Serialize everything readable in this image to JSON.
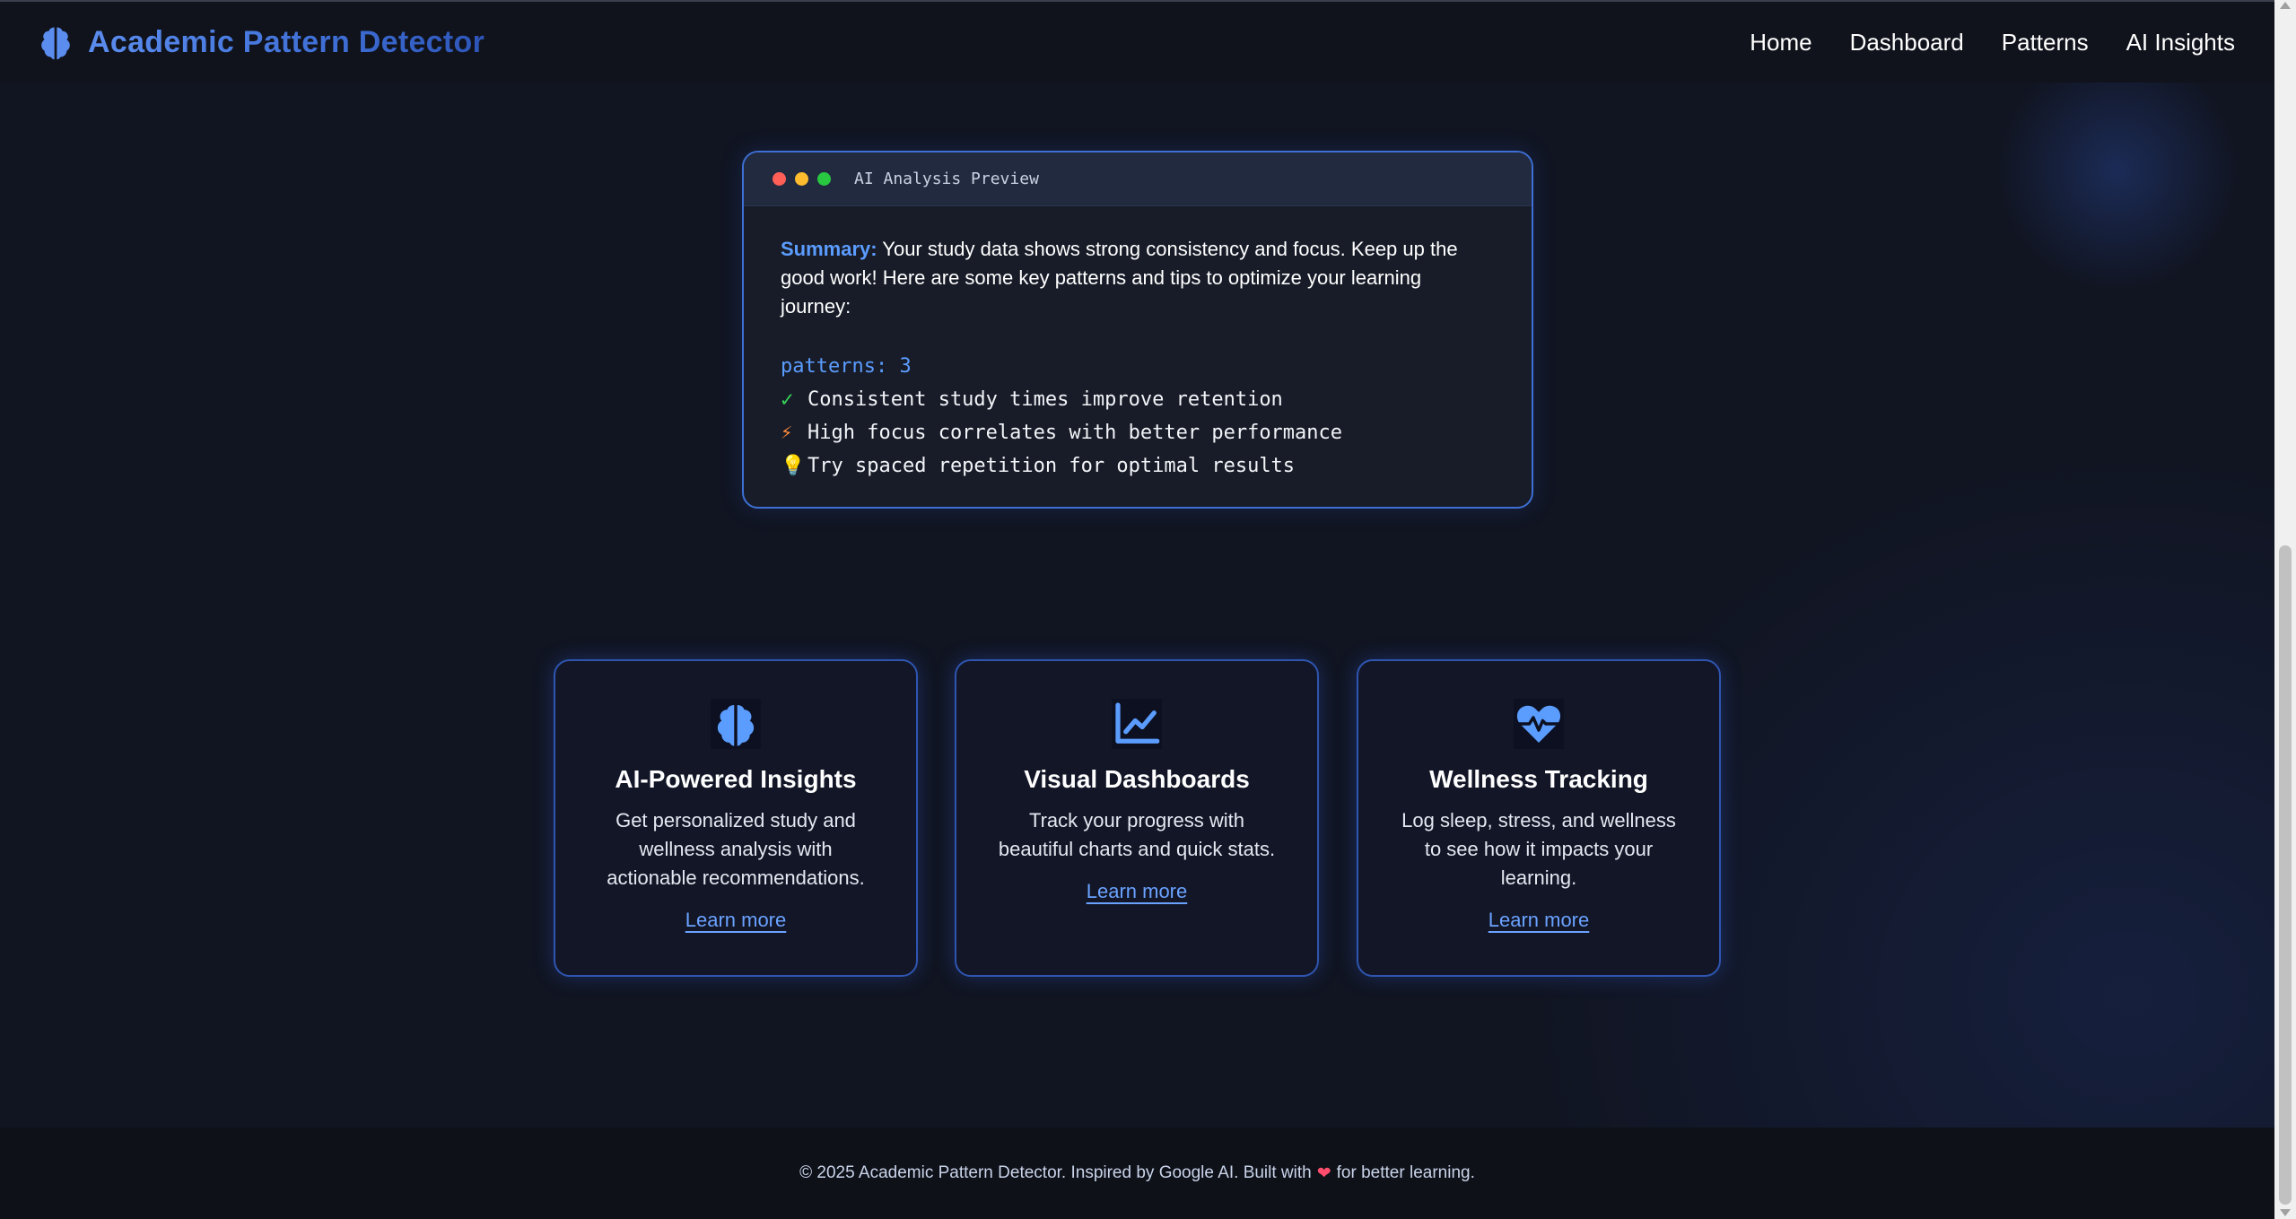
{
  "brand": {
    "title": "Academic Pattern Detector",
    "icon": "brain-icon"
  },
  "nav": {
    "items": [
      {
        "label": "Home"
      },
      {
        "label": "Dashboard"
      },
      {
        "label": "Patterns"
      },
      {
        "label": "AI Insights"
      }
    ]
  },
  "preview": {
    "title": "AI Analysis Preview",
    "summary_label": "Summary:",
    "summary_text": " Your study data shows strong consistency and focus. Keep up the good work! Here are some key patterns and tips to optimize your learning journey:",
    "patterns_key": "patterns:",
    "patterns_count": "3",
    "items": [
      {
        "symbol": "✓",
        "icon": "check-icon",
        "text": "Consistent study times improve retention"
      },
      {
        "symbol": "⚡",
        "icon": "lightning-icon",
        "text": "High focus correlates with better performance"
      },
      {
        "symbol": "💡",
        "icon": "lightbulb-icon",
        "text": "Try spaced repetition for optimal results"
      }
    ]
  },
  "cards": [
    {
      "icon": "brain-icon",
      "title": "AI-Powered Insights",
      "text": "Get personalized study and wellness analysis with actionable recommendations.",
      "link": "Learn more"
    },
    {
      "icon": "chart-line-icon",
      "title": "Visual Dashboards",
      "text": "Track your progress with beautiful charts and quick stats.",
      "link": "Learn more"
    },
    {
      "icon": "heart-pulse-icon",
      "title": "Wellness Tracking",
      "text": "Log sleep, stress, and wellness to see how it impacts your learning.",
      "link": "Learn more"
    }
  ],
  "footer": {
    "text_before": "© 2025 Academic Pattern Detector. Inspired by Google AI. Built with",
    "heart": "❤",
    "text_after": "for better learning."
  },
  "colors": {
    "accent": "#5b9cff",
    "card_border": "#2f55b0",
    "background": "#111522"
  }
}
